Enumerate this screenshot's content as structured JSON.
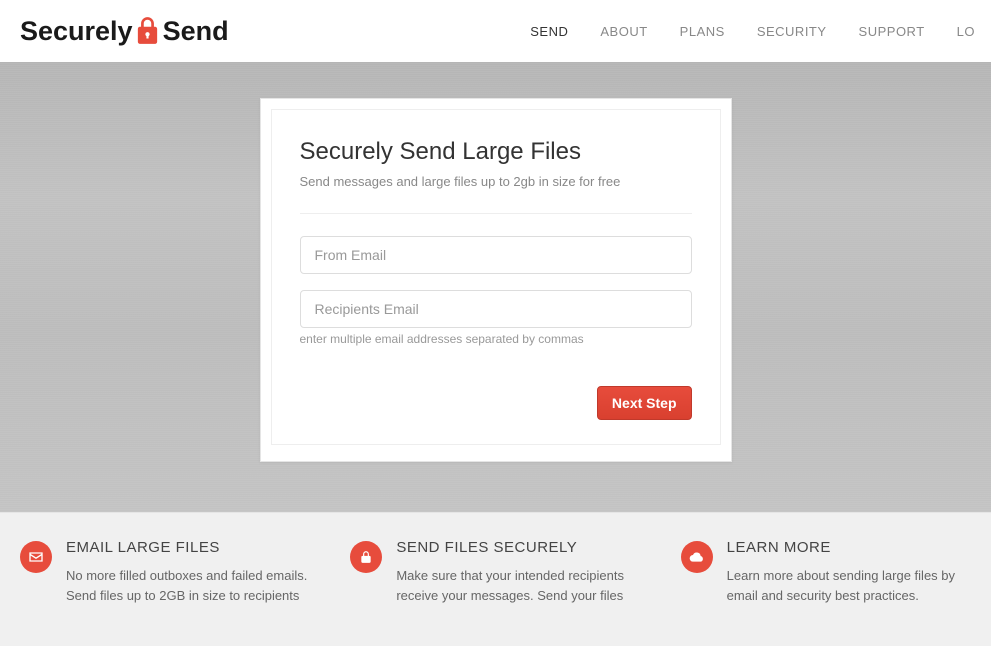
{
  "brand": {
    "word1": "Securely",
    "word2": "Send"
  },
  "nav": {
    "items": [
      {
        "label": "SEND",
        "active": true
      },
      {
        "label": "ABOUT",
        "active": false
      },
      {
        "label": "PLANS",
        "active": false
      },
      {
        "label": "SECURITY",
        "active": false
      },
      {
        "label": "SUPPORT",
        "active": false
      },
      {
        "label": "LO",
        "active": false
      }
    ]
  },
  "form": {
    "title": "Securely Send Large Files",
    "subtitle": "Send messages and large files up to 2gb in size for free",
    "from_placeholder": "From Email",
    "recipients_placeholder": "Recipients Email",
    "recipients_help": "enter multiple email addresses separated by commas",
    "next_label": "Next Step"
  },
  "features": [
    {
      "icon": "envelope-icon",
      "title": "EMAIL LARGE FILES",
      "body": "No more filled outboxes and failed emails. Send files up to 2GB in size to recipients"
    },
    {
      "icon": "lock-icon",
      "title": "SEND FILES SECURELY",
      "body": "Make sure that your intended recipients receive your messages. Send your files"
    },
    {
      "icon": "cloud-icon",
      "title": "LEARN MORE",
      "body": "Learn more about sending large files by email and security best practices."
    }
  ],
  "colors": {
    "accent": "#e74c3c"
  }
}
